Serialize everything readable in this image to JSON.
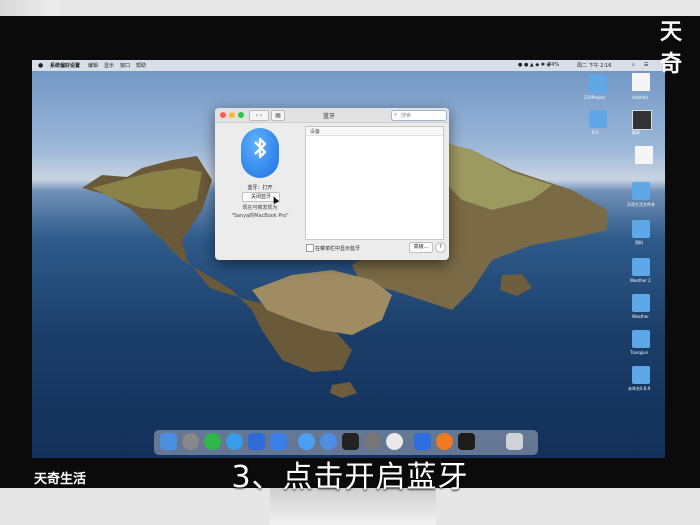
{
  "menubar": {
    "app_name": "系统偏好设置",
    "items": [
      "编辑",
      "显示",
      "窗口",
      "帮助"
    ],
    "battery": "74%",
    "clock": "周二 下午 2:16"
  },
  "bluetooth_window": {
    "title": "蓝牙",
    "search_placeholder": "搜索",
    "status": "蓝牙：打开",
    "toggle_button": "关闭蓝牙",
    "discoverable_line1": "现在可被发现为",
    "device_name": "\"Sanya的MacBook Pro\"",
    "devices_header": "设备",
    "show_in_menubar_label": "在菜单栏中显示蓝牙",
    "advanced_button": "高级...",
    "help_button": "?"
  },
  "desktop_icons": [
    {
      "label": "220Project"
    },
    {
      "label": "Untitled"
    },
    {
      "label": "0.3"
    },
    {
      "label": "截屏"
    },
    {
      "label": "天奇生活文件夹"
    },
    {
      "label": "资料"
    },
    {
      "label": "Weather 2"
    },
    {
      "label": "Weather"
    },
    {
      "label": "Tianqijun"
    },
    {
      "label": "未命名0.8.9"
    }
  ],
  "caption": "3、点击开启蓝牙",
  "watermark_bottom": "天奇生活",
  "watermark_top": "天奇"
}
